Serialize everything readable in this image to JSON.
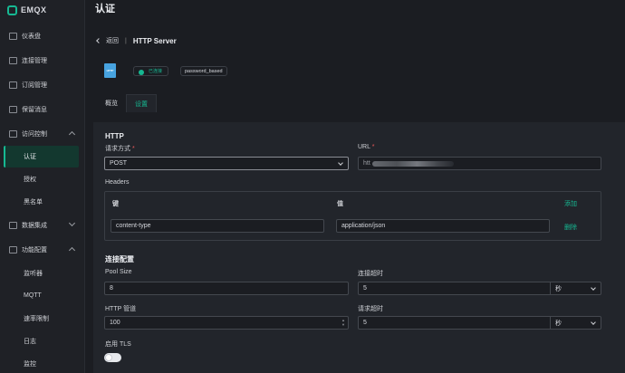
{
  "app": {
    "logo_text": "EMQX"
  },
  "sidebar": {
    "items": [
      {
        "label": "仪表盘",
        "icon": "dashboard-icon"
      },
      {
        "label": "连接管理",
        "icon": "connections-icon"
      },
      {
        "label": "订阅管理",
        "icon": "subscriptions-icon"
      },
      {
        "label": "保留消息",
        "icon": "retained-icon"
      },
      {
        "label": "访问控制",
        "icon": "shield-icon",
        "expanded": true
      },
      {
        "label": "数据集成",
        "icon": "integration-icon",
        "expanded": false
      },
      {
        "label": "功能配置",
        "icon": "settings-icon",
        "expanded": true
      }
    ],
    "access_sub": [
      "认证",
      "授权",
      "黑名单"
    ],
    "config_sub": [
      "监听器",
      "MQTT",
      "速率限制",
      "日志",
      "监控"
    ]
  },
  "header": {
    "title": "认证"
  },
  "page": {
    "back_label": "返回",
    "title": "HTTP Server",
    "file_icon_text": "HTTP",
    "status_label": "已连接",
    "mechanism_tag": "password_based",
    "tabs": [
      {
        "label": "概览",
        "active": false
      },
      {
        "label": "设置",
        "active": true
      }
    ]
  },
  "form": {
    "http_section": "HTTP",
    "method_label": "请求方式",
    "method_value": "POST",
    "url_label": "URL",
    "url_prefix": "htt",
    "headers_label": "Headers",
    "headers_key_col": "键",
    "headers_value_col": "值",
    "add_label": "添加",
    "header_rows": [
      {
        "key": "content-type",
        "value": "application/json",
        "delete_label": "删除"
      }
    ],
    "conn_section": "连接配置",
    "pool_size_label": "Pool Size",
    "pool_size_value": "8",
    "connect_timeout_label": "连接超时",
    "connect_timeout_value": "5",
    "connect_timeout_unit": "秒",
    "http_pipeline_label": "HTTP 管道",
    "http_pipeline_value": "100",
    "request_timeout_label": "请求超时",
    "request_timeout_value": "5",
    "request_timeout_unit": "秒",
    "tls_label": "启用 TLS",
    "tls_enabled": false
  },
  "colors": {
    "accent": "#16b892",
    "background": "#1b1d22",
    "card": "#22252b",
    "required": "#ec5a5a"
  }
}
